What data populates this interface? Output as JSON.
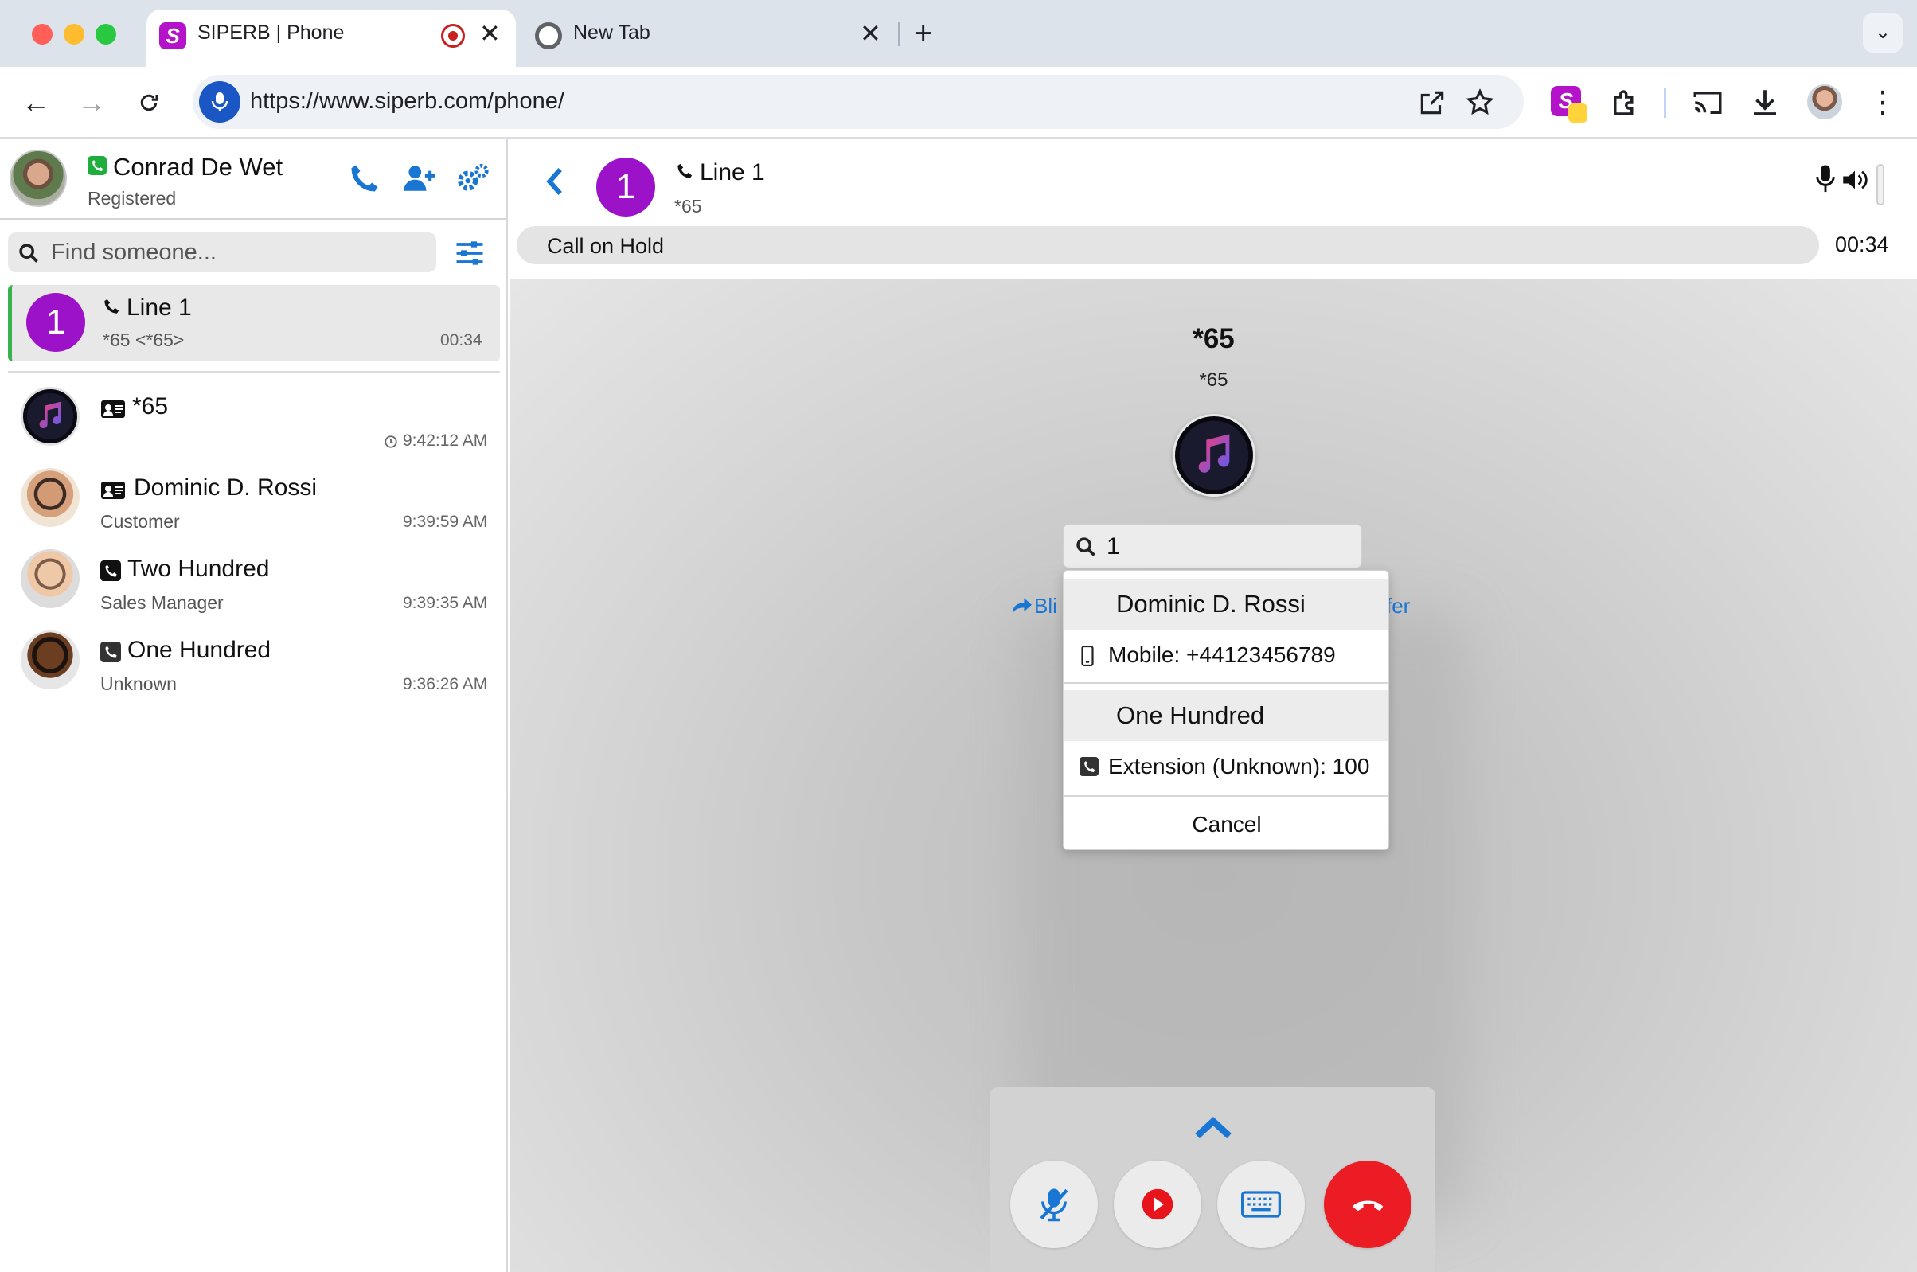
{
  "browser": {
    "tabs": [
      {
        "title": "SIPERB | Phone",
        "active": true
      },
      {
        "title": "New Tab",
        "active": false
      }
    ],
    "url": "https://www.siperb.com/phone/"
  },
  "sidebar": {
    "user": {
      "name": "Conrad De Wet",
      "status": "Registered"
    },
    "search": {
      "placeholder": "Find someone..."
    },
    "active_line": {
      "avatar": "1",
      "title": "Line 1",
      "subtitle": "*65 <*65>",
      "duration": "00:34"
    },
    "contacts": [
      {
        "name": "*65",
        "subtitle": "",
        "time": "9:42:12 AM",
        "type_icon": "contact-card-icon"
      },
      {
        "name": "Dominic D. Rossi",
        "subtitle": "Customer",
        "time": "9:39:59 AM",
        "type_icon": "contact-card-icon"
      },
      {
        "name": "Two Hundred",
        "subtitle": "Sales Manager",
        "time": "9:39:35 AM",
        "type_icon": "phone-square-icon"
      },
      {
        "name": "One Hundred",
        "subtitle": "Unknown",
        "time": "9:36:26 AM",
        "type_icon": "phone-square-icon"
      }
    ]
  },
  "call": {
    "avatar": "1",
    "line_title": "Line 1",
    "line_number": "*65",
    "status": "Call on Hold",
    "timer": "00:34",
    "callee_name": "*65",
    "callee_number": "*65"
  },
  "transfer": {
    "search_value": "1",
    "blind_label_partial": "Bli",
    "attended_label_partial": "fer",
    "groups": [
      {
        "name": "Dominic D. Rossi",
        "option": "Mobile: +44123456789"
      },
      {
        "name": "One Hundred",
        "option": "Extension (Unknown): 100"
      }
    ],
    "cancel_label": "Cancel"
  },
  "colors": {
    "accent": "#1976d2",
    "line_avatar": "#9c12c8",
    "end_call": "#ec1c24",
    "registered": "#1fae3e"
  }
}
